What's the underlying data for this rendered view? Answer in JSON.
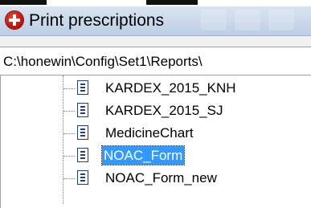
{
  "window": {
    "title": "Print prescriptions",
    "icon": "red-cross-icon"
  },
  "path": {
    "value": "C:\\honewin\\Config\\Set1\\Reports\\"
  },
  "tree": {
    "items": [
      {
        "label": "KARDEX_2015_KNH",
        "selected": false
      },
      {
        "label": "KARDEX_2015_SJ",
        "selected": false
      },
      {
        "label": "MedicineChart",
        "selected": false
      },
      {
        "label": "NOAC_Form",
        "selected": true
      },
      {
        "label": "NOAC_Form_new",
        "selected": false
      }
    ],
    "item_icon": "document-icon"
  },
  "colors": {
    "selection": "#3399ff",
    "title_gradient_top": "#d9e4f1",
    "title_gradient_bottom": "#bccde3"
  }
}
